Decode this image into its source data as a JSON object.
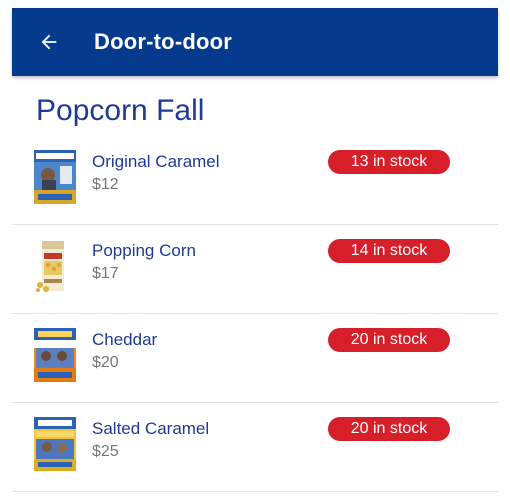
{
  "header": {
    "title": "Door-to-door",
    "back_icon": "arrow-left-icon"
  },
  "section": {
    "title": "Popcorn Fall"
  },
  "colors": {
    "appbar": "#053a8c",
    "title_text": "#1f3a93",
    "badge": "#d71f2a",
    "price_text": "#777777"
  },
  "products": [
    {
      "name": "Original Caramel",
      "price": "$12",
      "stock": "13 in stock",
      "image": "original-caramel-package-image"
    },
    {
      "name": "Popping Corn",
      "price": "$17",
      "stock": "14 in stock",
      "image": "popping-corn-bag-image"
    },
    {
      "name": "Cheddar",
      "price": "$20",
      "stock": "20 in stock",
      "image": "cheddar-package-image"
    },
    {
      "name": "Salted Caramel",
      "price": "$25",
      "stock": "20 in stock",
      "image": "salted-caramel-package-image"
    }
  ]
}
